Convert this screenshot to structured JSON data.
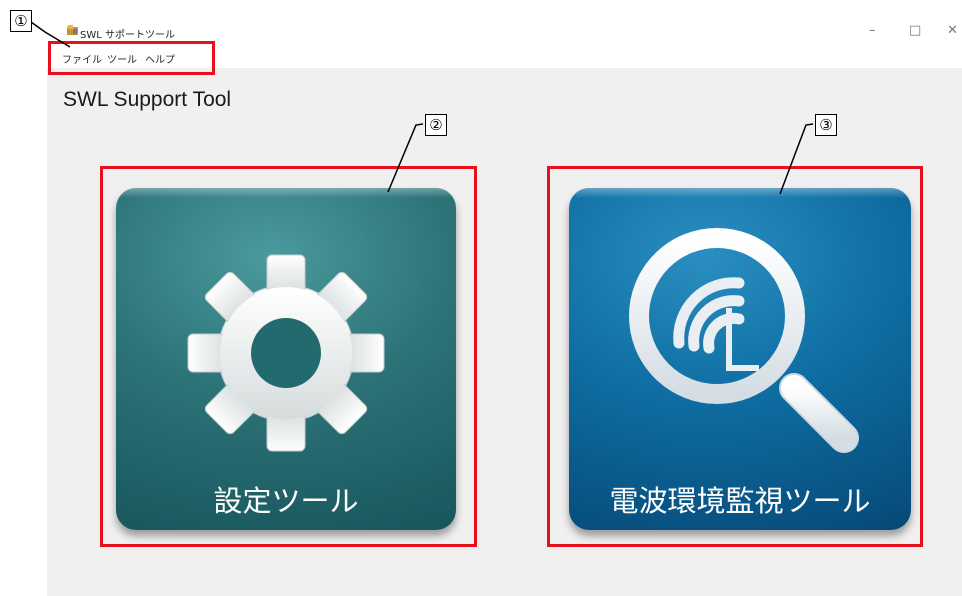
{
  "window": {
    "title": "SWL サポートツール",
    "controls": {
      "minimize": "–",
      "maximize": "□",
      "close": "✕"
    }
  },
  "menu": {
    "items": [
      {
        "label": "ファイル"
      },
      {
        "label": "ツール"
      },
      {
        "label": "ヘルプ"
      }
    ]
  },
  "heading": "SWL Support Tool",
  "tiles": {
    "settings": {
      "label": "設定ツール",
      "icon": "gear-icon",
      "color": "#2c7378"
    },
    "monitor": {
      "label": "電波環境監視ツール",
      "icon": "magnifier-signal-icon",
      "color": "#0f6ea3"
    }
  },
  "annotations": {
    "marker_1": "①",
    "marker_2": "②",
    "marker_3": "③",
    "box_color": "#e8111b"
  }
}
